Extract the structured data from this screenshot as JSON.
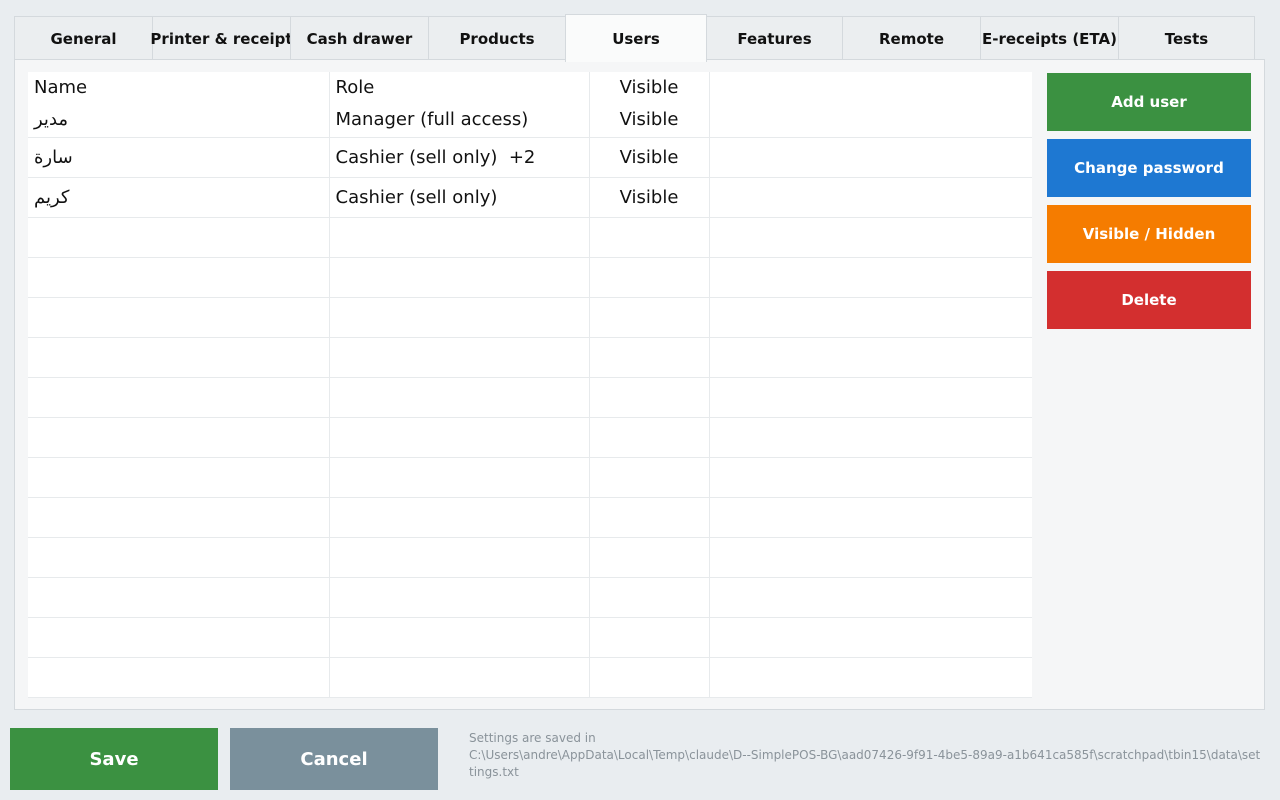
{
  "tabs": [
    {
      "label": "General",
      "active": false
    },
    {
      "label": "Printer & receipt",
      "active": false
    },
    {
      "label": "Cash drawer",
      "active": false
    },
    {
      "label": "Products",
      "active": false
    },
    {
      "label": "Users",
      "active": true
    },
    {
      "label": "Features",
      "active": false
    },
    {
      "label": "Remote",
      "active": false
    },
    {
      "label": "E-receipts (ETA)",
      "active": false
    },
    {
      "label": "Tests",
      "active": false
    }
  ],
  "users_table": {
    "headers": [
      "Name",
      "Role",
      "Visible"
    ],
    "rows": [
      {
        "name": "مدير",
        "role": "Manager (full access)",
        "visible": "Visible"
      },
      {
        "name": "سارة",
        "role": "Cashier (sell only)  +2",
        "visible": "Visible"
      },
      {
        "name": "كريم",
        "role": "Cashier (sell only)",
        "visible": "Visible"
      }
    ]
  },
  "actions": {
    "add_user": "Add user",
    "change_password": "Change password",
    "visible_hidden": "Visible / Hidden",
    "delete": "Delete"
  },
  "footer": {
    "save": "Save",
    "cancel": "Cancel",
    "settings_note": "Settings are saved in",
    "settings_path": "C:\\Users\\andre\\AppData\\Local\\Temp\\claude\\D--SimplePOS-BG\\aad07426-9f91-4be5-89a9-a1b641ca585f\\scratchpad\\tbin15\\data\\settings.txt"
  },
  "colors": {
    "green": "#3b9141",
    "blue": "#1e78d2",
    "orange": "#f57c00",
    "red": "#d32f2f",
    "grey": "#7a909c"
  }
}
